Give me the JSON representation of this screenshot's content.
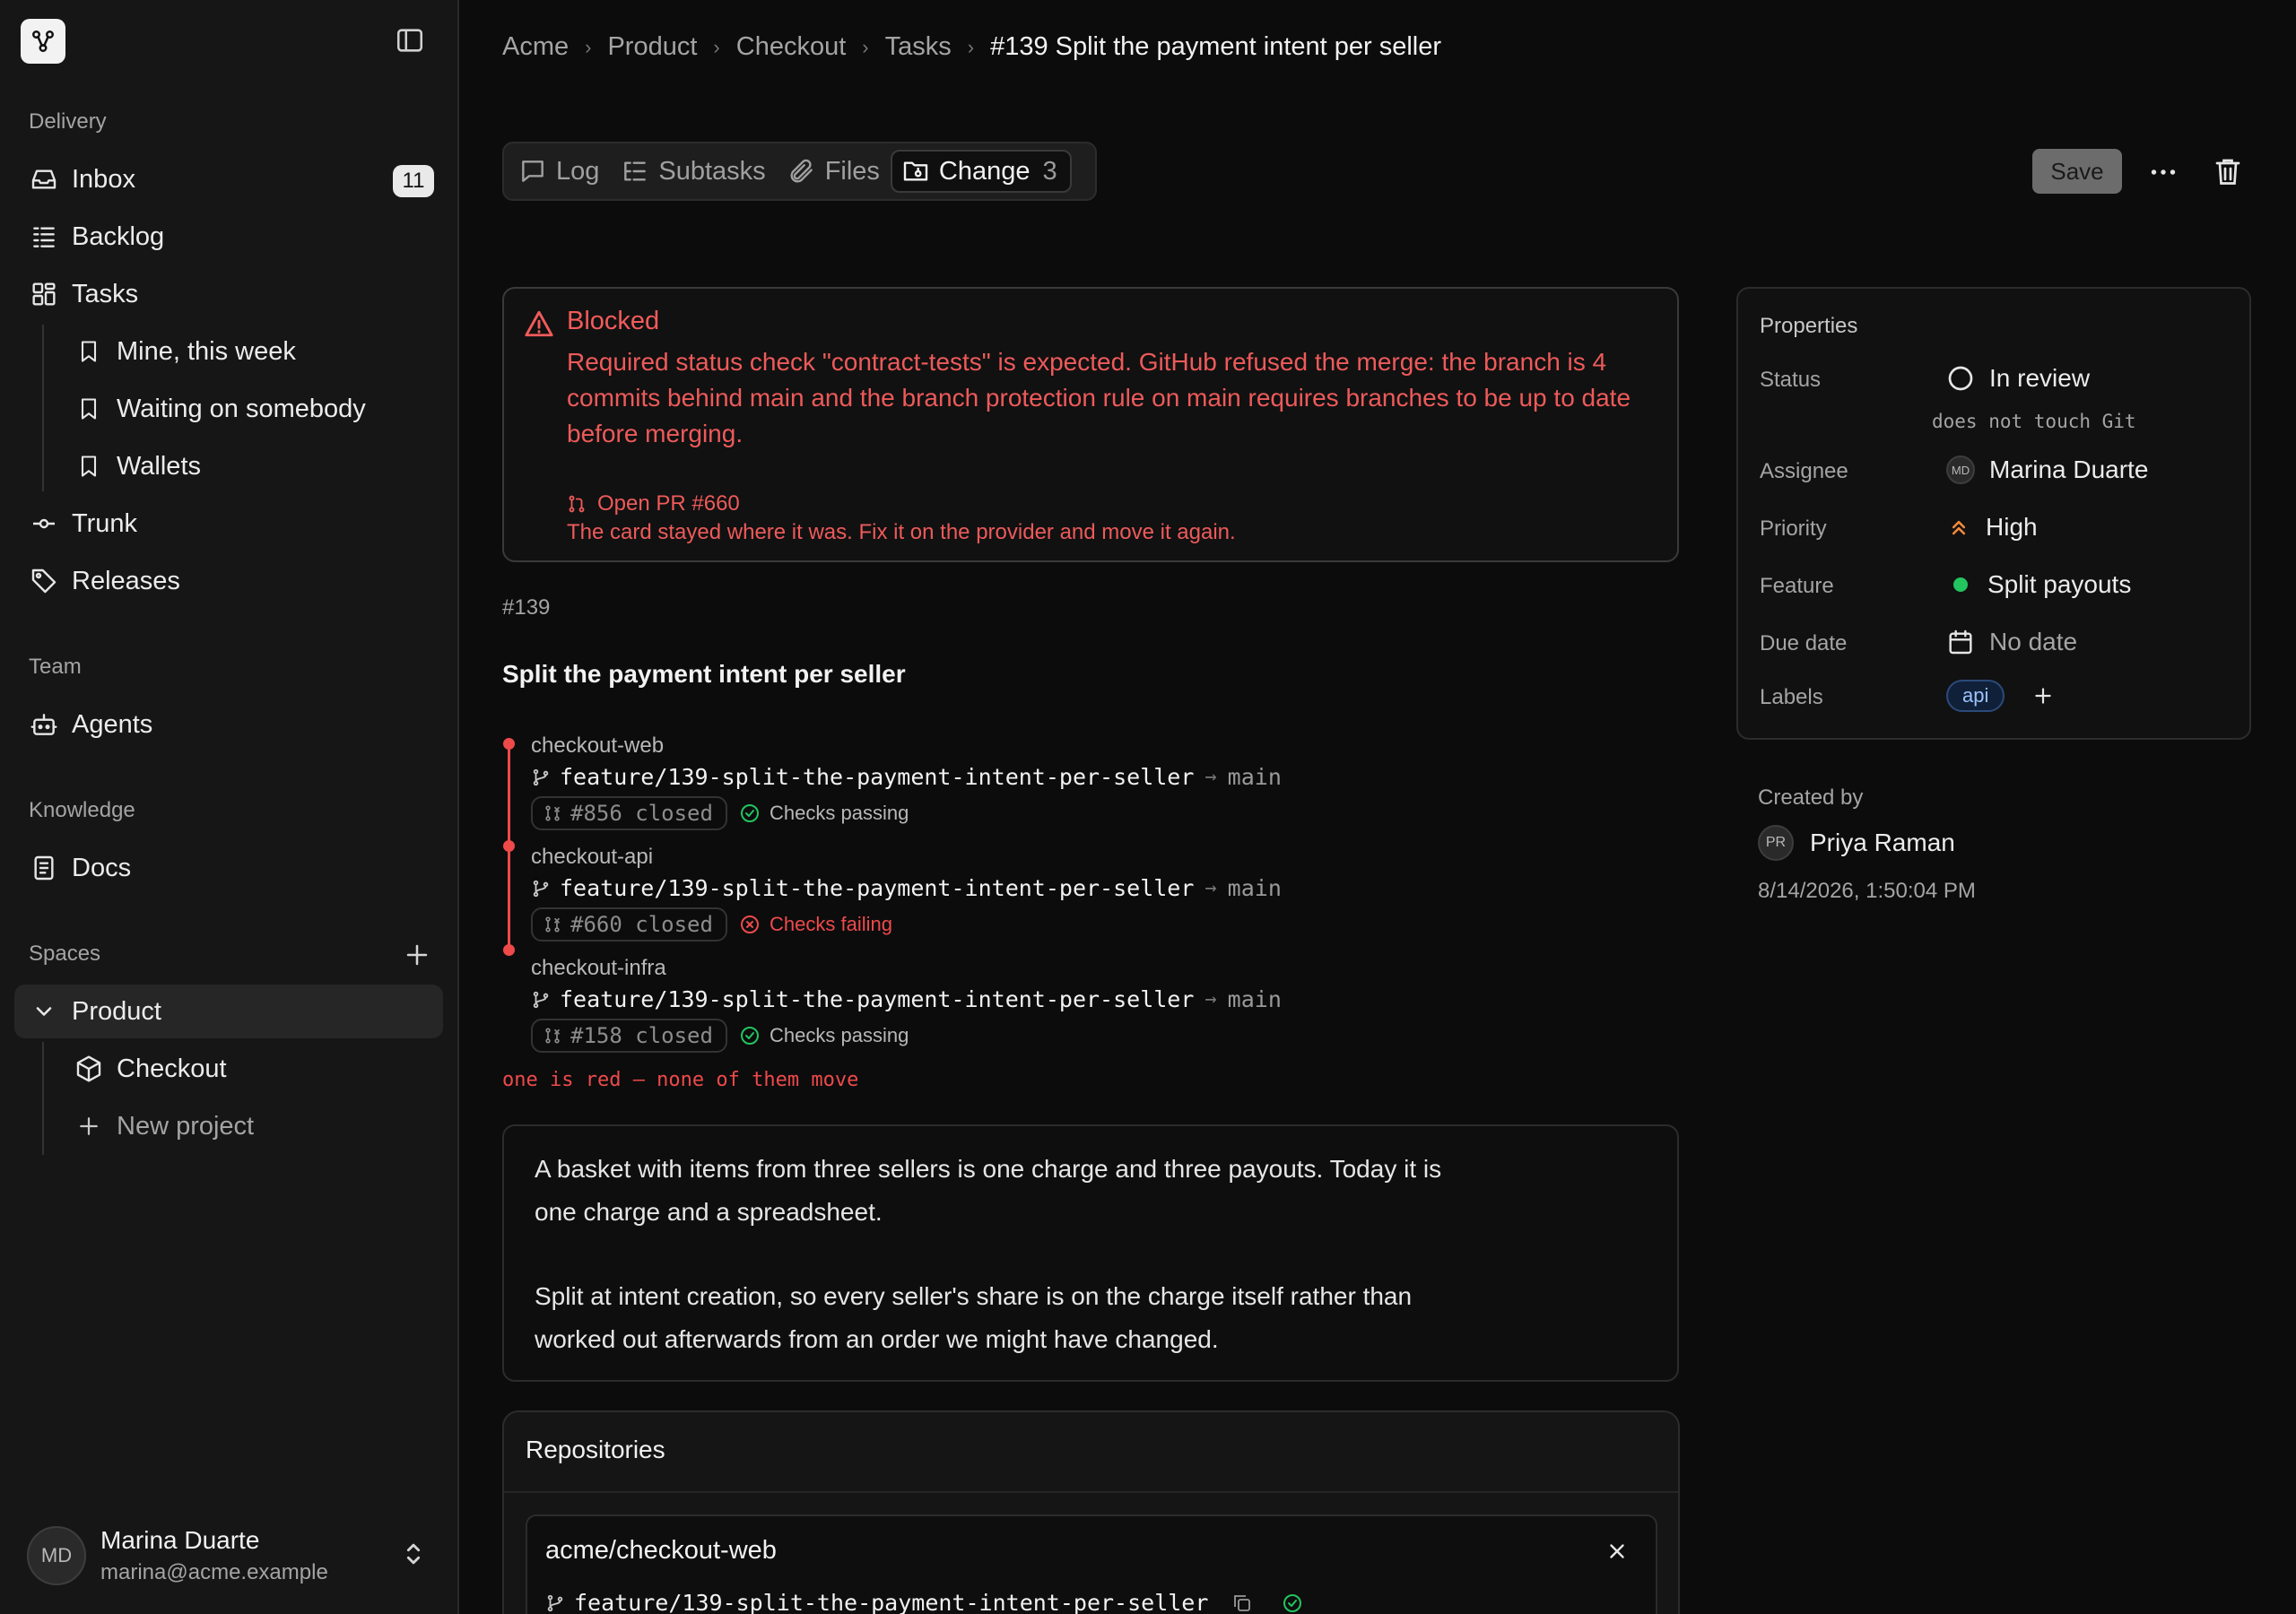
{
  "sidebar": {
    "sections": {
      "delivery": "Delivery",
      "team": "Team",
      "knowledge": "Knowledge",
      "spaces": "Spaces"
    },
    "items": {
      "inbox": {
        "label": "Inbox",
        "badge": "11"
      },
      "backlog": {
        "label": "Backlog"
      },
      "tasks": {
        "label": "Tasks"
      },
      "mine": {
        "label": "Mine, this week"
      },
      "waiting": {
        "label": "Waiting on somebody"
      },
      "wallets": {
        "label": "Wallets"
      },
      "trunk": {
        "label": "Trunk"
      },
      "releases": {
        "label": "Releases"
      },
      "agents": {
        "label": "Agents"
      },
      "docs": {
        "label": "Docs"
      },
      "product": {
        "label": "Product"
      },
      "checkout": {
        "label": "Checkout"
      },
      "new_project": {
        "label": "New project"
      }
    },
    "user": {
      "initials": "MD",
      "name": "Marina Duarte",
      "email": "marina@acme.example"
    }
  },
  "breadcrumb": [
    "Acme",
    "Product",
    "Checkout",
    "Tasks",
    "#139 Split the payment intent per seller"
  ],
  "tabs": {
    "log": "Log",
    "subtasks": "Subtasks",
    "files": "Files",
    "change": "Change",
    "change_count": "3"
  },
  "toolbar": {
    "save_label": "Save"
  },
  "blocked": {
    "title": "Blocked",
    "message": "Required status check \"contract-tests\" is expected. GitHub refused the merge: the branch is 4 commits behind main and the branch protection rule on main requires branches to be up to date before merging.",
    "pr_link": "Open PR #660",
    "note": "The card stayed where it was. Fix it on the provider and move it again."
  },
  "task": {
    "id": "#139",
    "title": "Split the payment intent per seller"
  },
  "branches": [
    {
      "repo": "checkout-web",
      "branch": "feature/139-split-the-payment-intent-per-seller",
      "arrow": "→",
      "target": "main",
      "pr": "#856 closed",
      "check": "Checks passing",
      "status": "pass"
    },
    {
      "repo": "checkout-api",
      "branch": "feature/139-split-the-payment-intent-per-seller",
      "arrow": "→",
      "target": "main",
      "pr": "#660 closed",
      "check": "Checks failing",
      "status": "fail"
    },
    {
      "repo": "checkout-infra",
      "branch": "feature/139-split-the-payment-intent-per-seller",
      "arrow": "→",
      "target": "main",
      "pr": "#158 closed",
      "check": "Checks passing",
      "status": "pass"
    }
  ],
  "branch_warning": "one is red — none of them move",
  "description": {
    "p1": "A basket with items from three sellers is one charge and three payouts. Today it is one charge and a spreadsheet.",
    "p2": "Split at intent creation, so every seller's share is on the charge itself rather than worked out afterwards from an order we might have changed."
  },
  "repositories": {
    "header": "Repositories",
    "items": [
      {
        "name": "acme/checkout-web",
        "branch": "feature/139-split-the-payment-intent-per-seller"
      }
    ]
  },
  "properties": {
    "header": "Properties",
    "status_label": "Status",
    "status_value": "In review",
    "status_note": "does not touch Git",
    "assignee_label": "Assignee",
    "assignee_initials": "MD",
    "assignee_value": "Marina Duarte",
    "priority_label": "Priority",
    "priority_value": "High",
    "feature_label": "Feature",
    "feature_value": "Split payouts",
    "due_label": "Due date",
    "due_value": "No date",
    "labels_label": "Labels",
    "labels": [
      "api"
    ]
  },
  "created": {
    "label": "Created by",
    "initials": "PR",
    "name": "Priya Raman",
    "date": "8/14/2026, 1:50:04 PM"
  },
  "colors": {
    "accent_red": "#ee4a4a",
    "check_green": "#22c55e",
    "priority_orange": "#f28a3c",
    "label_blue": "#9cc2ff"
  }
}
